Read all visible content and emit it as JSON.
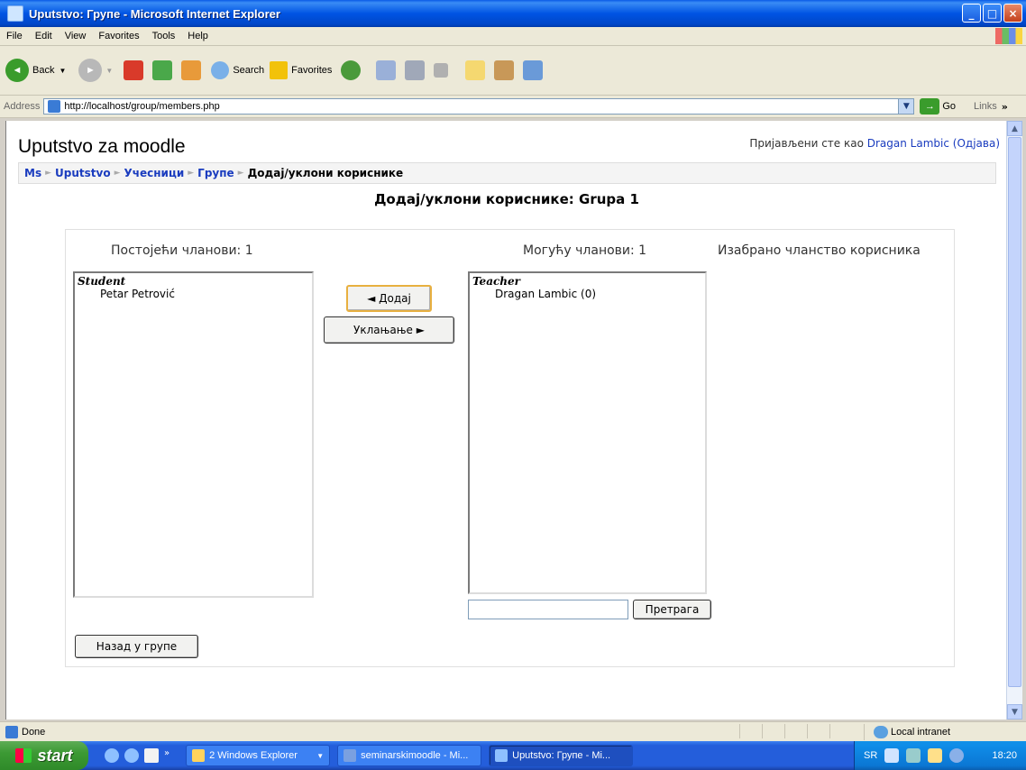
{
  "window": {
    "title": "Uputstvo: Групе - Microsoft Internet Explorer",
    "controls": [
      "_",
      "□",
      "×"
    ]
  },
  "menu": [
    "File",
    "Edit",
    "View",
    "Favorites",
    "Tools",
    "Help"
  ],
  "toolbar": {
    "back": "Back",
    "search": "Search",
    "favorites": "Favorites"
  },
  "address": {
    "label": "Address",
    "url": "http://localhost/group/members.php",
    "go": "Go",
    "links": "Links"
  },
  "page": {
    "site_name": "Uputstvo za moodle",
    "login_prefix": "Пријављени сте као ",
    "login_user": "Dragan Lambic",
    "login_logout": "(Одјава)",
    "breadcrumb": [
      "Ms",
      "Uputstvo",
      "Учесници",
      "Групе",
      "Додај/уклони кориснике"
    ],
    "heading": "Додај/уклони кориснике: Grupa 1",
    "existing_members_label": "Постојећи чланови: 1",
    "potential_members_label": "Могућу чланови: 1",
    "selected_membership_label": "Изабрано чланство корисника",
    "existing_group": "Student",
    "existing_members": [
      "Petar Petrović"
    ],
    "potential_group": "Teacher",
    "potential_members": [
      "Dragan Lambic (0)"
    ],
    "add_button": "◄ Додај",
    "remove_button": "Уклањање ►",
    "search_button": "Претрага",
    "search_value": "",
    "back_button": "Назад у групе"
  },
  "status": {
    "text": "Done",
    "zone": "Local intranet"
  },
  "taskbar": {
    "start": "start",
    "tasks": [
      "2 Windows Explorer",
      "seminarskimoodle - Mi...",
      "Uputstvo: Групе - Mi..."
    ],
    "language": "SR",
    "clock": "18:20"
  }
}
